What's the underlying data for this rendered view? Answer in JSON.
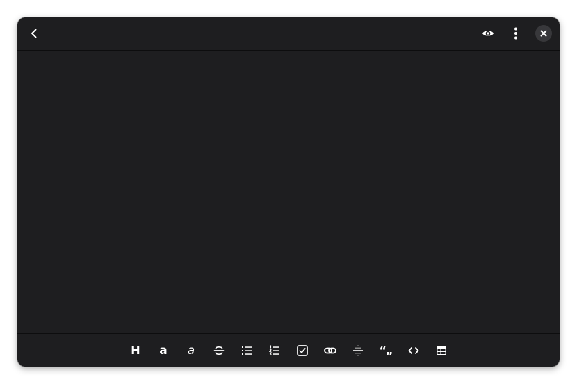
{
  "window": {
    "background": "#1e1e20",
    "accent_color": "#ffffff"
  },
  "header": {
    "back_icon": "chevron-left-icon",
    "preview_icon": "eye-icon",
    "menu_icon": "vertical-dots-icon",
    "close_icon": "close-icon"
  },
  "editor": {
    "content": ""
  },
  "toolbar": {
    "heading_label": "H",
    "bold_label": "a",
    "italic_label": "a",
    "quote_label": "“„",
    "items": [
      "heading-icon",
      "bold-icon",
      "italic-icon",
      "strikethrough-icon",
      "bulleted-list-icon",
      "numbered-list-icon",
      "checkbox-icon",
      "link-icon",
      "horizontal-rule-icon",
      "quote-icon",
      "code-icon",
      "table-icon"
    ]
  }
}
